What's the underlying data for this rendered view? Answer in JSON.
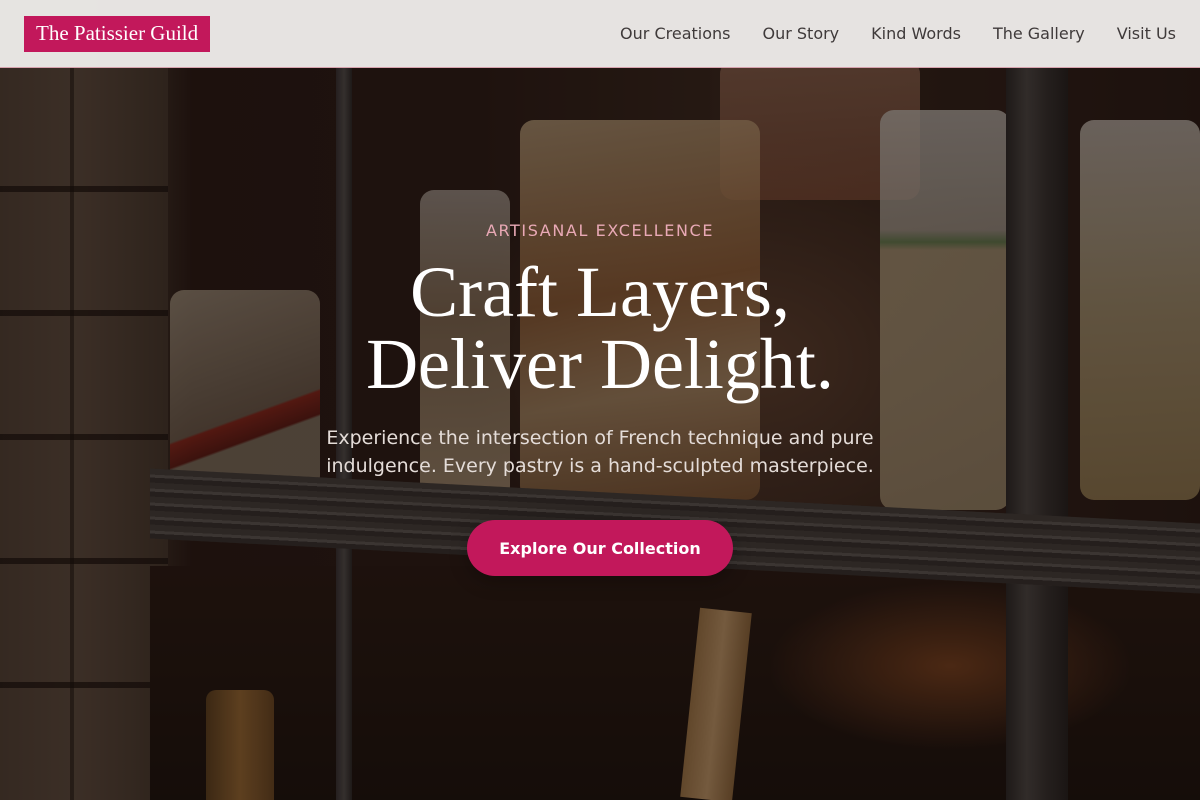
{
  "brand": {
    "name": "The Patissier Guild",
    "accent": "#c2185b"
  },
  "nav": {
    "links": [
      {
        "label": "Our Creations"
      },
      {
        "label": "Our Story"
      },
      {
        "label": "Kind Words"
      },
      {
        "label": "The Gallery"
      },
      {
        "label": "Visit Us"
      }
    ]
  },
  "hero": {
    "eyebrow": "ARTISANAL EXCELLENCE",
    "headline_line1": "Craft Layers,",
    "headline_line2": "Deliver Delight.",
    "subtext": "Experience the intersection of French technique and pure indulgence. Every pastry is a hand-sculpted masterpiece.",
    "cta_label": "Explore Our Collection",
    "background_image": "pastry-shop-shelves-photo"
  }
}
